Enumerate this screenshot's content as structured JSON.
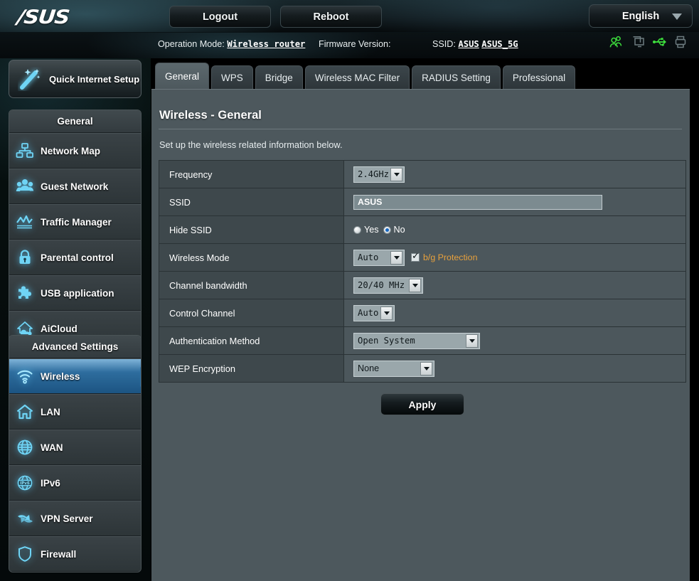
{
  "header": {
    "logo_text": "/SUS",
    "logout_label": "Logout",
    "reboot_label": "Reboot",
    "language": "English"
  },
  "infostrip": {
    "operation_mode_label": "Operation Mode:",
    "operation_mode_value": "Wireless router",
    "firmware_label": "Firmware Version:",
    "firmware_value": "",
    "ssid_label": "SSID:",
    "ssid_value_1": "ASUS",
    "ssid_value_2": "ASUS_5G",
    "icons": [
      "users-icon",
      "screens-icon",
      "usb-icon",
      "printer-icon"
    ]
  },
  "sidebar": {
    "quick_setup_label": "Quick Internet Setup",
    "groups": [
      {
        "title": "General",
        "items": [
          {
            "label": "Network Map",
            "icon": "network-map-icon",
            "active": false
          },
          {
            "label": "Guest Network",
            "icon": "guest-network-icon",
            "active": false
          },
          {
            "label": "Traffic Manager",
            "icon": "traffic-manager-icon",
            "active": false
          },
          {
            "label": "Parental control",
            "icon": "lock-icon",
            "active": false
          },
          {
            "label": "USB application",
            "icon": "puzzle-icon",
            "active": false
          },
          {
            "label": "AiCloud",
            "icon": "cloud-icon",
            "active": false
          }
        ]
      },
      {
        "title": "Advanced Settings",
        "items": [
          {
            "label": "Wireless",
            "icon": "wifi-icon",
            "active": true
          },
          {
            "label": "LAN",
            "icon": "house-icon",
            "active": false
          },
          {
            "label": "WAN",
            "icon": "globe-icon",
            "active": false
          },
          {
            "label": "IPv6",
            "icon": "ipv6-globe-icon",
            "active": false
          },
          {
            "label": "VPN Server",
            "icon": "vpn-icon",
            "active": false
          },
          {
            "label": "Firewall",
            "icon": "shield-icon",
            "active": false
          }
        ]
      }
    ]
  },
  "tabs": [
    {
      "label": "General",
      "active": true
    },
    {
      "label": "WPS",
      "active": false
    },
    {
      "label": "Bridge",
      "active": false
    },
    {
      "label": "Wireless MAC Filter",
      "active": false
    },
    {
      "label": "RADIUS Setting",
      "active": false
    },
    {
      "label": "Professional",
      "active": false
    }
  ],
  "page": {
    "title": "Wireless - General",
    "description": "Set up the wireless related information below."
  },
  "form": {
    "frequency": {
      "label": "Frequency",
      "value": "2.4GHz"
    },
    "ssid": {
      "label": "SSID",
      "value": "ASUS",
      "placeholder": ""
    },
    "hide_ssid": {
      "label": "Hide SSID",
      "options": [
        {
          "label": "Yes",
          "checked": false
        },
        {
          "label": "No",
          "checked": true
        }
      ]
    },
    "wireless_mode": {
      "label": "Wireless Mode",
      "value": "Auto",
      "checkbox_label": "b/g Protection",
      "checkbox_checked": true,
      "checkbox_color": "#e8a13c"
    },
    "channel_bandwidth": {
      "label": "Channel bandwidth",
      "value": "20/40 MHz"
    },
    "control_channel": {
      "label": "Control Channel",
      "value": "Auto"
    },
    "auth_method": {
      "label": "Authentication Method",
      "value": "Open System"
    },
    "wep_encryption": {
      "label": "WEP Encryption",
      "value": "None"
    },
    "apply_label": "Apply"
  },
  "colors": {
    "accent_blue": "#2e6d9e",
    "icon_cyan": "#6fd4f5",
    "panel_bg": "#4d585d",
    "row_label_bg": "#3e484c",
    "row_value_bg": "#4c575c",
    "warning_orange": "#e8a13c",
    "status_green": "#3ddf3d"
  }
}
